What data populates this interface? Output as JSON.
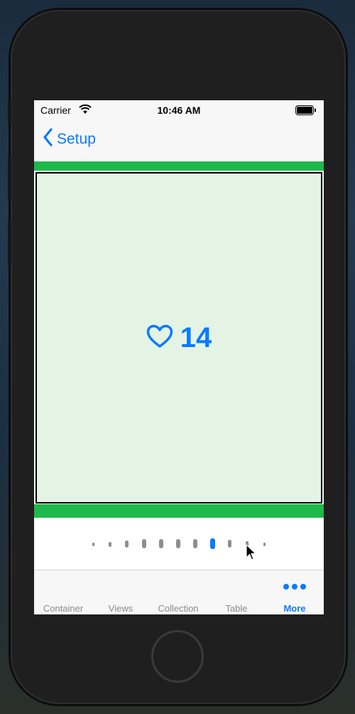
{
  "status_bar": {
    "carrier": "Carrier",
    "time": "10:46 AM"
  },
  "nav": {
    "back_label": "Setup"
  },
  "counter": {
    "icon": "heart-outline-icon",
    "count": "14"
  },
  "pager": {
    "dot_count": 11,
    "active_index": 7
  },
  "tabs": [
    {
      "label": "Container",
      "active": false
    },
    {
      "label": "Views",
      "active": false
    },
    {
      "label": "Collection",
      "active": false
    },
    {
      "label": "Table",
      "active": false
    },
    {
      "label": "More",
      "active": true,
      "icon": "ellipsis-icon"
    }
  ],
  "colors": {
    "accent": "#0a7aff",
    "green": "#1fb84b",
    "card_bg": "#e3f4e5"
  }
}
